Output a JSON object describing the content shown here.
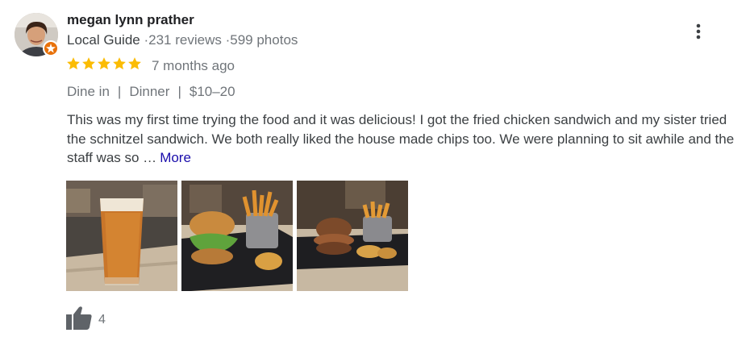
{
  "reviewer": {
    "name": "megan lynn prather",
    "level": "Local Guide",
    "reviews": "231 reviews",
    "photos": "599 photos",
    "separator": "·"
  },
  "rating": {
    "stars": 5,
    "age": "7 months ago"
  },
  "tags": {
    "service": "Dine in",
    "meal": "Dinner",
    "price": "$10–20",
    "separator": "|"
  },
  "review": {
    "text": "This was my first time trying the food and it was delicious! I got the fried chicken sandwich and my sister tried the schnitzel sandwich. We both really liked the house made chips too. We were planning to sit awhile and the staff was so …",
    "more_label": "More"
  },
  "photos": [
    {
      "subject": "beer-glass"
    },
    {
      "subject": "fried-chicken-sandwich"
    },
    {
      "subject": "schnitzel-sandwich"
    }
  ],
  "likes": {
    "count": "4"
  },
  "colors": {
    "star": "#fbbc04",
    "badge": "#e8710a",
    "link": "#1a0dab",
    "icon": "#5f6368"
  },
  "icons": {
    "menu": "more-vert-icon",
    "like": "thumbs-up-icon",
    "badge": "local-guide-badge-icon"
  }
}
